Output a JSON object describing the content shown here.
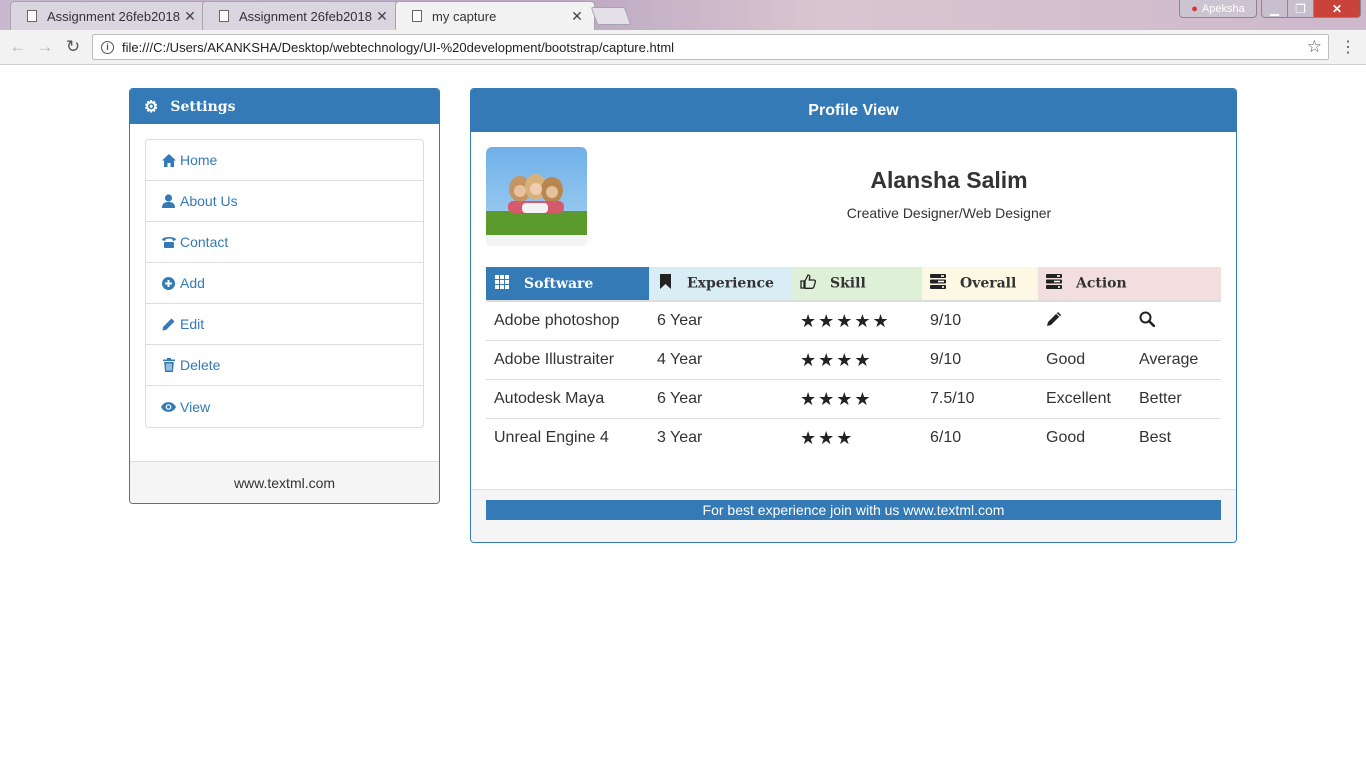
{
  "browser": {
    "tabs": [
      {
        "title": "Assignment 26feb2018",
        "active": false
      },
      {
        "title": "Assignment 26feb2018",
        "active": false
      },
      {
        "title": "my capture",
        "active": true
      }
    ],
    "profile_name": "Apeksha",
    "url": "file:///C:/Users/AKANKSHA/Desktop/webtechnology/UI-%20development/bootstrap/capture.html"
  },
  "settings": {
    "title": "Settings",
    "items": [
      {
        "label": "Home",
        "icon": "home-icon"
      },
      {
        "label": "About Us",
        "icon": "user-icon"
      },
      {
        "label": "Contact",
        "icon": "phone-icon"
      },
      {
        "label": "Add",
        "icon": "plus-circle-icon"
      },
      {
        "label": "Edit",
        "icon": "pencil-icon"
      },
      {
        "label": "Delete",
        "icon": "trash-icon"
      },
      {
        "label": "View",
        "icon": "eye-icon"
      }
    ],
    "footer": "www.textml.com"
  },
  "profile": {
    "title": "Profile View",
    "name": "Alansha Salim",
    "role": "Creative Designer/Web Designer",
    "table": {
      "headers": [
        {
          "label": "Software",
          "icon": "grid-icon"
        },
        {
          "label": "Experience",
          "icon": "bookmark-icon"
        },
        {
          "label": "Skill",
          "icon": "thumbs-up-icon"
        },
        {
          "label": "Overall",
          "icon": "tasks-icon"
        },
        {
          "label": "Action",
          "icon": "tasks-icon"
        }
      ],
      "rows": [
        {
          "software": "Adobe photoshop",
          "experience": "6 Year",
          "stars": 5,
          "overall": "9/10",
          "action1": "",
          "action1_icon": "pencil-icon",
          "action2": "",
          "action2_icon": "search-icon"
        },
        {
          "software": "Adobe Illustraiter",
          "experience": "4 Year",
          "stars": 4,
          "overall": "9/10",
          "action1": "Good",
          "action2": "Average"
        },
        {
          "software": "Autodesk Maya",
          "experience": "6 Year",
          "stars": 4,
          "overall": "7.5/10",
          "action1": "Excellent",
          "action2": "Better"
        },
        {
          "software": "Unreal Engine 4",
          "experience": "3 Year",
          "stars": 3,
          "overall": "6/10",
          "action1": "Good",
          "action2": "Best"
        }
      ]
    },
    "footer": "For best experience join with us www.textml.com"
  },
  "colors": {
    "primary": "#337ab7",
    "info": "#d9edf7",
    "success": "#dff0d8",
    "warning": "#fcf8e3",
    "danger": "#f2dede"
  }
}
